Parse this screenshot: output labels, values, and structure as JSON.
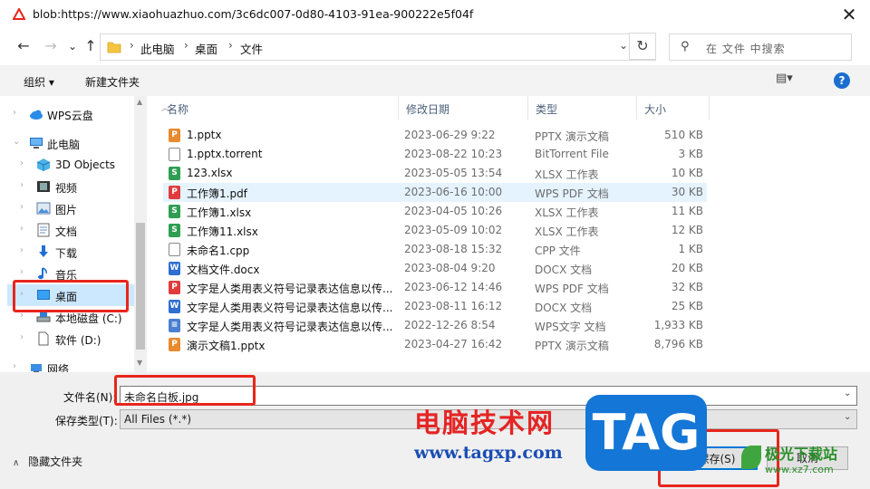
{
  "window": {
    "title": "blob:https://www.xiaohuazhuo.com/3c6dc007-0d80-4103-91ea-900222e5f04f",
    "close_glyph": "✕"
  },
  "nav": {
    "back": "←",
    "forward": "→",
    "up": "↑",
    "recent": "⌄",
    "refresh": "↻"
  },
  "address": {
    "crumbs": [
      "此电脑",
      "桌面",
      "文件"
    ],
    "sep": "›",
    "dropdown": "⌄"
  },
  "search": {
    "placeholder": "在 文件 中搜索",
    "icon": "⚲"
  },
  "toolbar": {
    "organize": "组织 ▾",
    "new_folder": "新建文件夹",
    "view": "▤▾",
    "help": "?"
  },
  "sidebar": {
    "items": [
      {
        "label": "WPS云盘",
        "icon": "cloud-icon"
      },
      {
        "label": "此电脑",
        "icon": "computer-icon"
      },
      {
        "label": "3D Objects",
        "icon": "3d-objects-icon"
      },
      {
        "label": "视频",
        "icon": "video-icon"
      },
      {
        "label": "图片",
        "icon": "pictures-icon"
      },
      {
        "label": "文档",
        "icon": "documents-icon"
      },
      {
        "label": "下载",
        "icon": "download-icon"
      },
      {
        "label": "音乐",
        "icon": "music-icon"
      },
      {
        "label": "桌面",
        "icon": "desktop-icon",
        "selected": true
      },
      {
        "label": "本地磁盘 (C:)",
        "icon": "drive-icon"
      },
      {
        "label": "软件 (D:)",
        "icon": "drive-icon"
      },
      {
        "label": "网络",
        "icon": "network-icon"
      }
    ]
  },
  "columns": {
    "name": "名称",
    "modified": "修改日期",
    "type": "类型",
    "size": "大小"
  },
  "files": [
    {
      "name": "1.pptx",
      "modified": "2023-06-29 9:22",
      "type": "PPTX 演示文稿",
      "size": "510 KB",
      "kind": "pptx"
    },
    {
      "name": "1.pptx.torrent",
      "modified": "2023-08-22 10:23",
      "type": "BitTorrent File",
      "size": "3 KB",
      "kind": "blank"
    },
    {
      "name": "123.xlsx",
      "modified": "2023-05-05 13:54",
      "type": "XLSX 工作表",
      "size": "10 KB",
      "kind": "xlsx"
    },
    {
      "name": "工作簿1.pdf",
      "modified": "2023-06-16 10:00",
      "type": "WPS PDF 文档",
      "size": "30 KB",
      "kind": "pdf"
    },
    {
      "name": "工作簿1.xlsx",
      "modified": "2023-04-05 10:26",
      "type": "XLSX 工作表",
      "size": "11 KB",
      "kind": "xlsx"
    },
    {
      "name": "工作簿11.xlsx",
      "modified": "2023-05-09 10:02",
      "type": "XLSX 工作表",
      "size": "12 KB",
      "kind": "xlsx"
    },
    {
      "name": "未命名1.cpp",
      "modified": "2023-08-18 15:32",
      "type": "CPP 文件",
      "size": "1 KB",
      "kind": "blank"
    },
    {
      "name": "文档文件.docx",
      "modified": "2023-08-04 9:20",
      "type": "DOCX 文档",
      "size": "20 KB",
      "kind": "docx"
    },
    {
      "name": "文字是人类用表义符号记录表达信息以传...",
      "modified": "2023-06-12 14:46",
      "type": "WPS PDF 文档",
      "size": "32 KB",
      "kind": "pdf"
    },
    {
      "name": "文字是人类用表义符号记录表达信息以传...",
      "modified": "2023-08-11 16:12",
      "type": "DOCX 文档",
      "size": "25 KB",
      "kind": "docx"
    },
    {
      "name": "文字是人类用表义符号记录表达信息以传...",
      "modified": "2022-12-26 8:54",
      "type": "WPS文字 文档",
      "size": "1,933 KB",
      "kind": "txt"
    },
    {
      "name": "演示文稿1.pptx",
      "modified": "2023-04-27 16:42",
      "type": "PPTX 演示文稿",
      "size": "8,796 KB",
      "kind": "pptx"
    }
  ],
  "form": {
    "filename_label": "文件名(N):",
    "filename_value": "未命名白板.jpg",
    "type_label": "保存类型(T):",
    "type_value": "All Files (*.*)",
    "hide_folders": "隐藏文件夹",
    "save": "保存(S)",
    "cancel": "取消"
  },
  "watermark": {
    "site_cn": "电脑技术网",
    "site_url": "www.tagxp.com",
    "tag": "TAG",
    "logo_cn": "极光下载站",
    "logo_url": "www.xz7.com"
  },
  "colors": {
    "accent": "#0078d7",
    "selected": "#cce8ff",
    "hover": "#e5f3ff",
    "highlight": "#e8261c"
  }
}
